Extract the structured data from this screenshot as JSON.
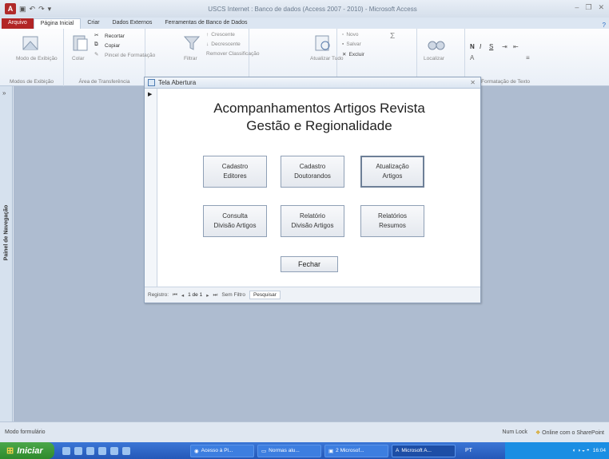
{
  "window": {
    "title": "USCS Internet : Banco de dados (Access 2007 - 2010)  -  Microsoft Access"
  },
  "ribbon_tabs": [
    "Arquivo",
    "Página Inicial",
    "Criar",
    "Dados Externos",
    "Ferramentas de Banco de Dados"
  ],
  "ribbon": {
    "views_group": {
      "label": "Modos de Exibição",
      "button": "Modo de Exibição"
    },
    "clipboard_group": {
      "label": "Área de Transferência",
      "paste": "Colar",
      "cut": "Recortar",
      "copy": "Copiar",
      "format_painter": "Pincel de Formatação"
    },
    "sort_group": {
      "filter": "Filtrar",
      "ascending": "Crescente",
      "descending": "Decrescente",
      "remove_sort": "Remover Classificação"
    },
    "records_group": {
      "refresh": "Atualizar Tudo",
      "new": "Novo",
      "save": "Salvar",
      "delete": "Excluir"
    },
    "find_group": {
      "find": "Localizar"
    },
    "text_format_group": {
      "label": "Formatação de Texto"
    }
  },
  "nav_pane": {
    "label": "Painel de Navegação",
    "collapse": "»"
  },
  "form": {
    "title": "Tela Abertura",
    "heading_line1": "Acompanhamentos Artigos Revista",
    "heading_line2": "Gestão e Regionalidade",
    "buttons": [
      {
        "label": "Cadastro\nEditores"
      },
      {
        "label": "Cadastro\nDoutorandos"
      },
      {
        "label": "Atualização\nArtigos"
      },
      {
        "label": "Consulta\nDivisão Artigos"
      },
      {
        "label": "Relatório\nDivisão Artigos"
      },
      {
        "label": "Relatórios\nResumos"
      }
    ],
    "close_button": "Fechar",
    "record_nav": {
      "label": "Registro:",
      "position": "1 de 1",
      "filter": "Sem Filtro",
      "search": "Pesquisar"
    }
  },
  "status": {
    "left": "Modo formulário",
    "num_lock": "Num Lock",
    "sharepoint": "Online com o SharePoint"
  },
  "taskbar": {
    "start": "Iniciar",
    "tasks": [
      "Acesso à Pl...",
      "Normas alu...",
      "2 Microsof...",
      "Microsoft A..."
    ],
    "lang": "PT",
    "clock": "16:04"
  }
}
